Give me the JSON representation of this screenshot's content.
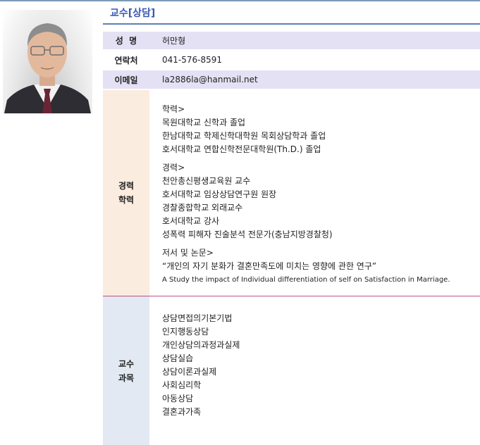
{
  "header": {
    "title": "교수[상담]"
  },
  "profile": {
    "name_label": "성  명",
    "name": "허만형",
    "phone_label": "연락처",
    "phone": "041-576-8591",
    "email_label": "이메일",
    "email": "la2886la@hanmail.net"
  },
  "career": {
    "label_line1": "경력",
    "label_line2": "학력",
    "education_heading": "학력>",
    "education": [
      "목원대학교 신학과 졸업",
      "한남대학교 학제신학대학원 목회상담학과 졸업",
      "호서대학교 연합신학전문대학원(Th.D.) 졸업"
    ],
    "experience_heading": "경력>",
    "experience": [
      "천안총신평생교육원 교수",
      "호서대학교 임상상담연구원 원장",
      "경찰종합학교 외래교수",
      "호서대학교 강사",
      "성폭력 피해자 진술분석 전문가(충남지방경찰청)"
    ],
    "papers_heading": "저서 및 논문>",
    "papers": [
      "“개인의 자기 분화가 결혼만족도에 미치는 영향에 관한 연구”",
      "A Study the impact of Individual differentiation of self on Satisfaction in Marriage."
    ]
  },
  "courses": {
    "label_line1": "교수",
    "label_line2": "과목",
    "items": [
      "상담면접의기본기법",
      "인지행동상담",
      "개인상담의과정과실제",
      "상담실습",
      "상담이론과실제",
      "사회심리학",
      "아동상담",
      "결혼과가족"
    ]
  }
}
